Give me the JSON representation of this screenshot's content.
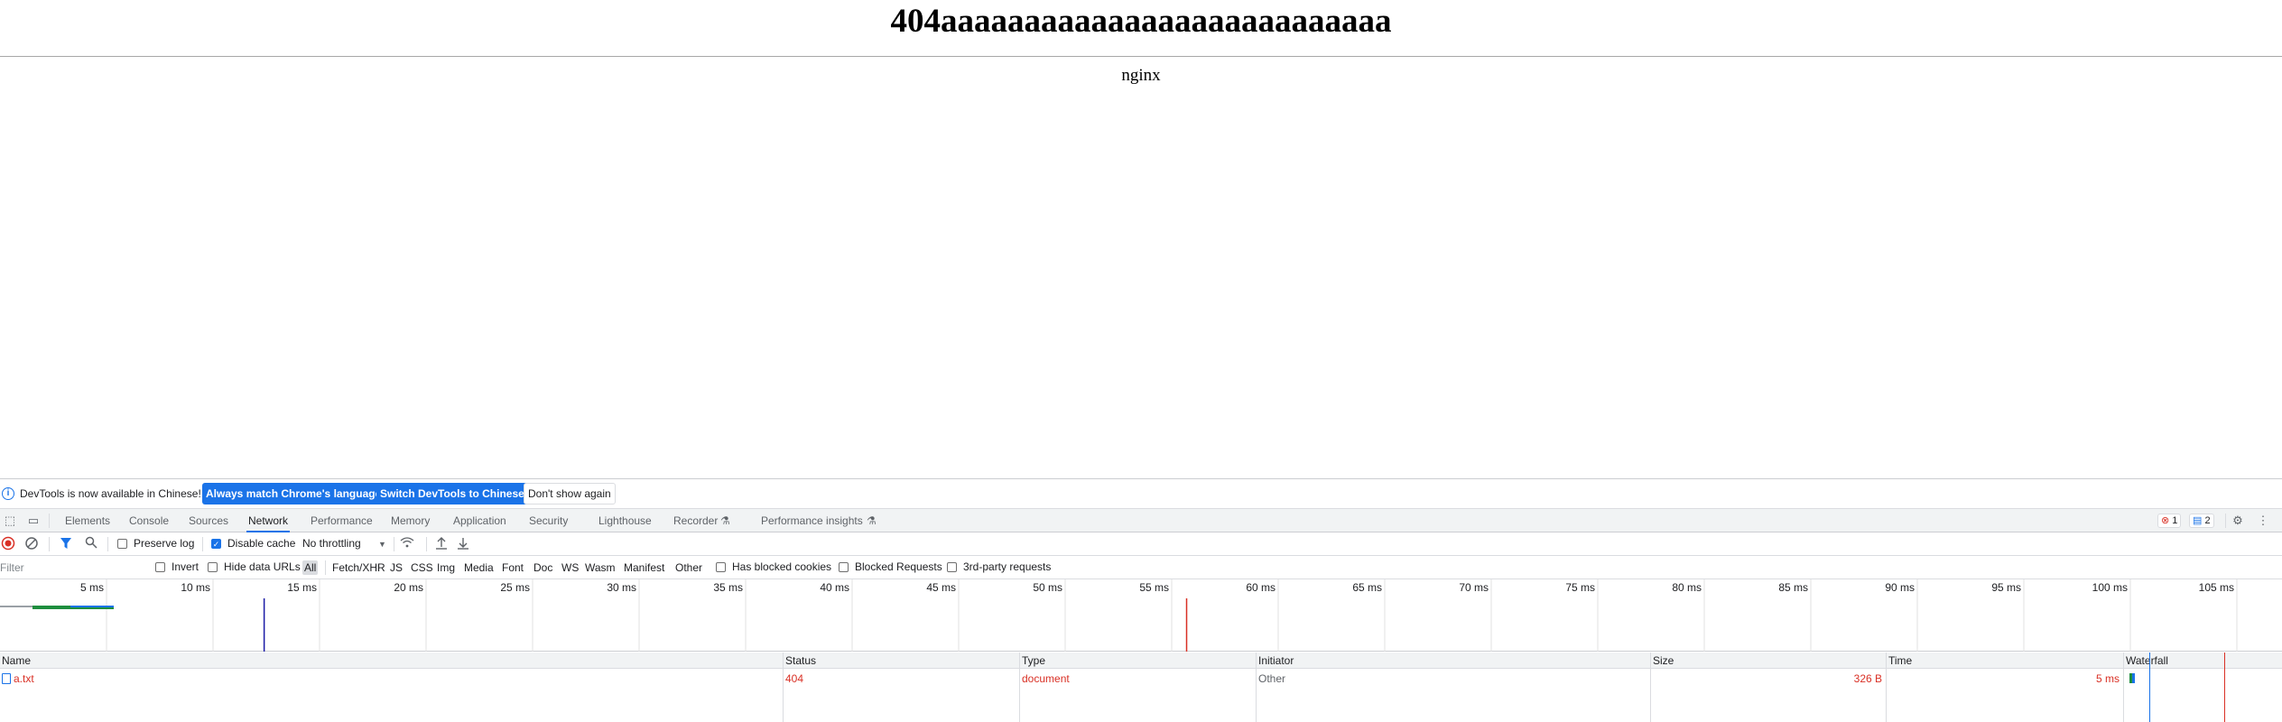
{
  "page": {
    "heading": "404aaaaaaaaaaaaaaaaaaaaaaaaaaa",
    "footer": "nginx"
  },
  "infobar": {
    "message": "DevTools is now available in Chinese!",
    "btn_match": "Always match Chrome's language",
    "btn_switch": "Switch DevTools to Chinese",
    "btn_dismiss": "Don't show again"
  },
  "tabs": [
    "Elements",
    "Console",
    "Sources",
    "Network",
    "Performance",
    "Memory",
    "Application",
    "Security",
    "Lighthouse",
    "Recorder",
    "Performance insights"
  ],
  "active_tab": "Network",
  "badges": {
    "errors": "1",
    "messages": "2"
  },
  "toolbar": {
    "preserve_log": "Preserve log",
    "disable_cache": "Disable cache",
    "throttling": "No throttling"
  },
  "filterbar": {
    "placeholder": "Filter",
    "invert": "Invert",
    "hide_data_urls": "Hide data URLs",
    "types": [
      "All",
      "Fetch/XHR",
      "JS",
      "CSS",
      "Img",
      "Media",
      "Font",
      "Doc",
      "WS",
      "Wasm",
      "Manifest",
      "Other"
    ],
    "selected_type": "All",
    "blocked_cookies": "Has blocked cookies",
    "blocked_requests": "Blocked Requests",
    "third_party": "3rd-party requests"
  },
  "overview": {
    "ticks": [
      "5 ms",
      "10 ms",
      "15 ms",
      "20 ms",
      "25 ms",
      "30 ms",
      "35 ms",
      "40 ms",
      "45 ms",
      "50 ms",
      "55 ms",
      "60 ms",
      "65 ms",
      "70 ms",
      "75 ms",
      "80 ms",
      "85 ms",
      "90 ms",
      "95 ms",
      "100 ms",
      "105 ms"
    ],
    "dom_content_loaded_ms": 12.4,
    "load_ms": 55.7,
    "colors": {
      "dcl": "#1a1aa6",
      "load": "#d93025",
      "request": "#1e8e3e",
      "receive": "#1a73e8"
    }
  },
  "table": {
    "headers": [
      "Name",
      "Status",
      "Type",
      "Initiator",
      "Size",
      "Time",
      "Waterfall"
    ],
    "rows": [
      {
        "name": "a.txt",
        "status": "404",
        "type": "document",
        "initiator": "Other",
        "size": "326 B",
        "time": "5 ms"
      }
    ]
  }
}
